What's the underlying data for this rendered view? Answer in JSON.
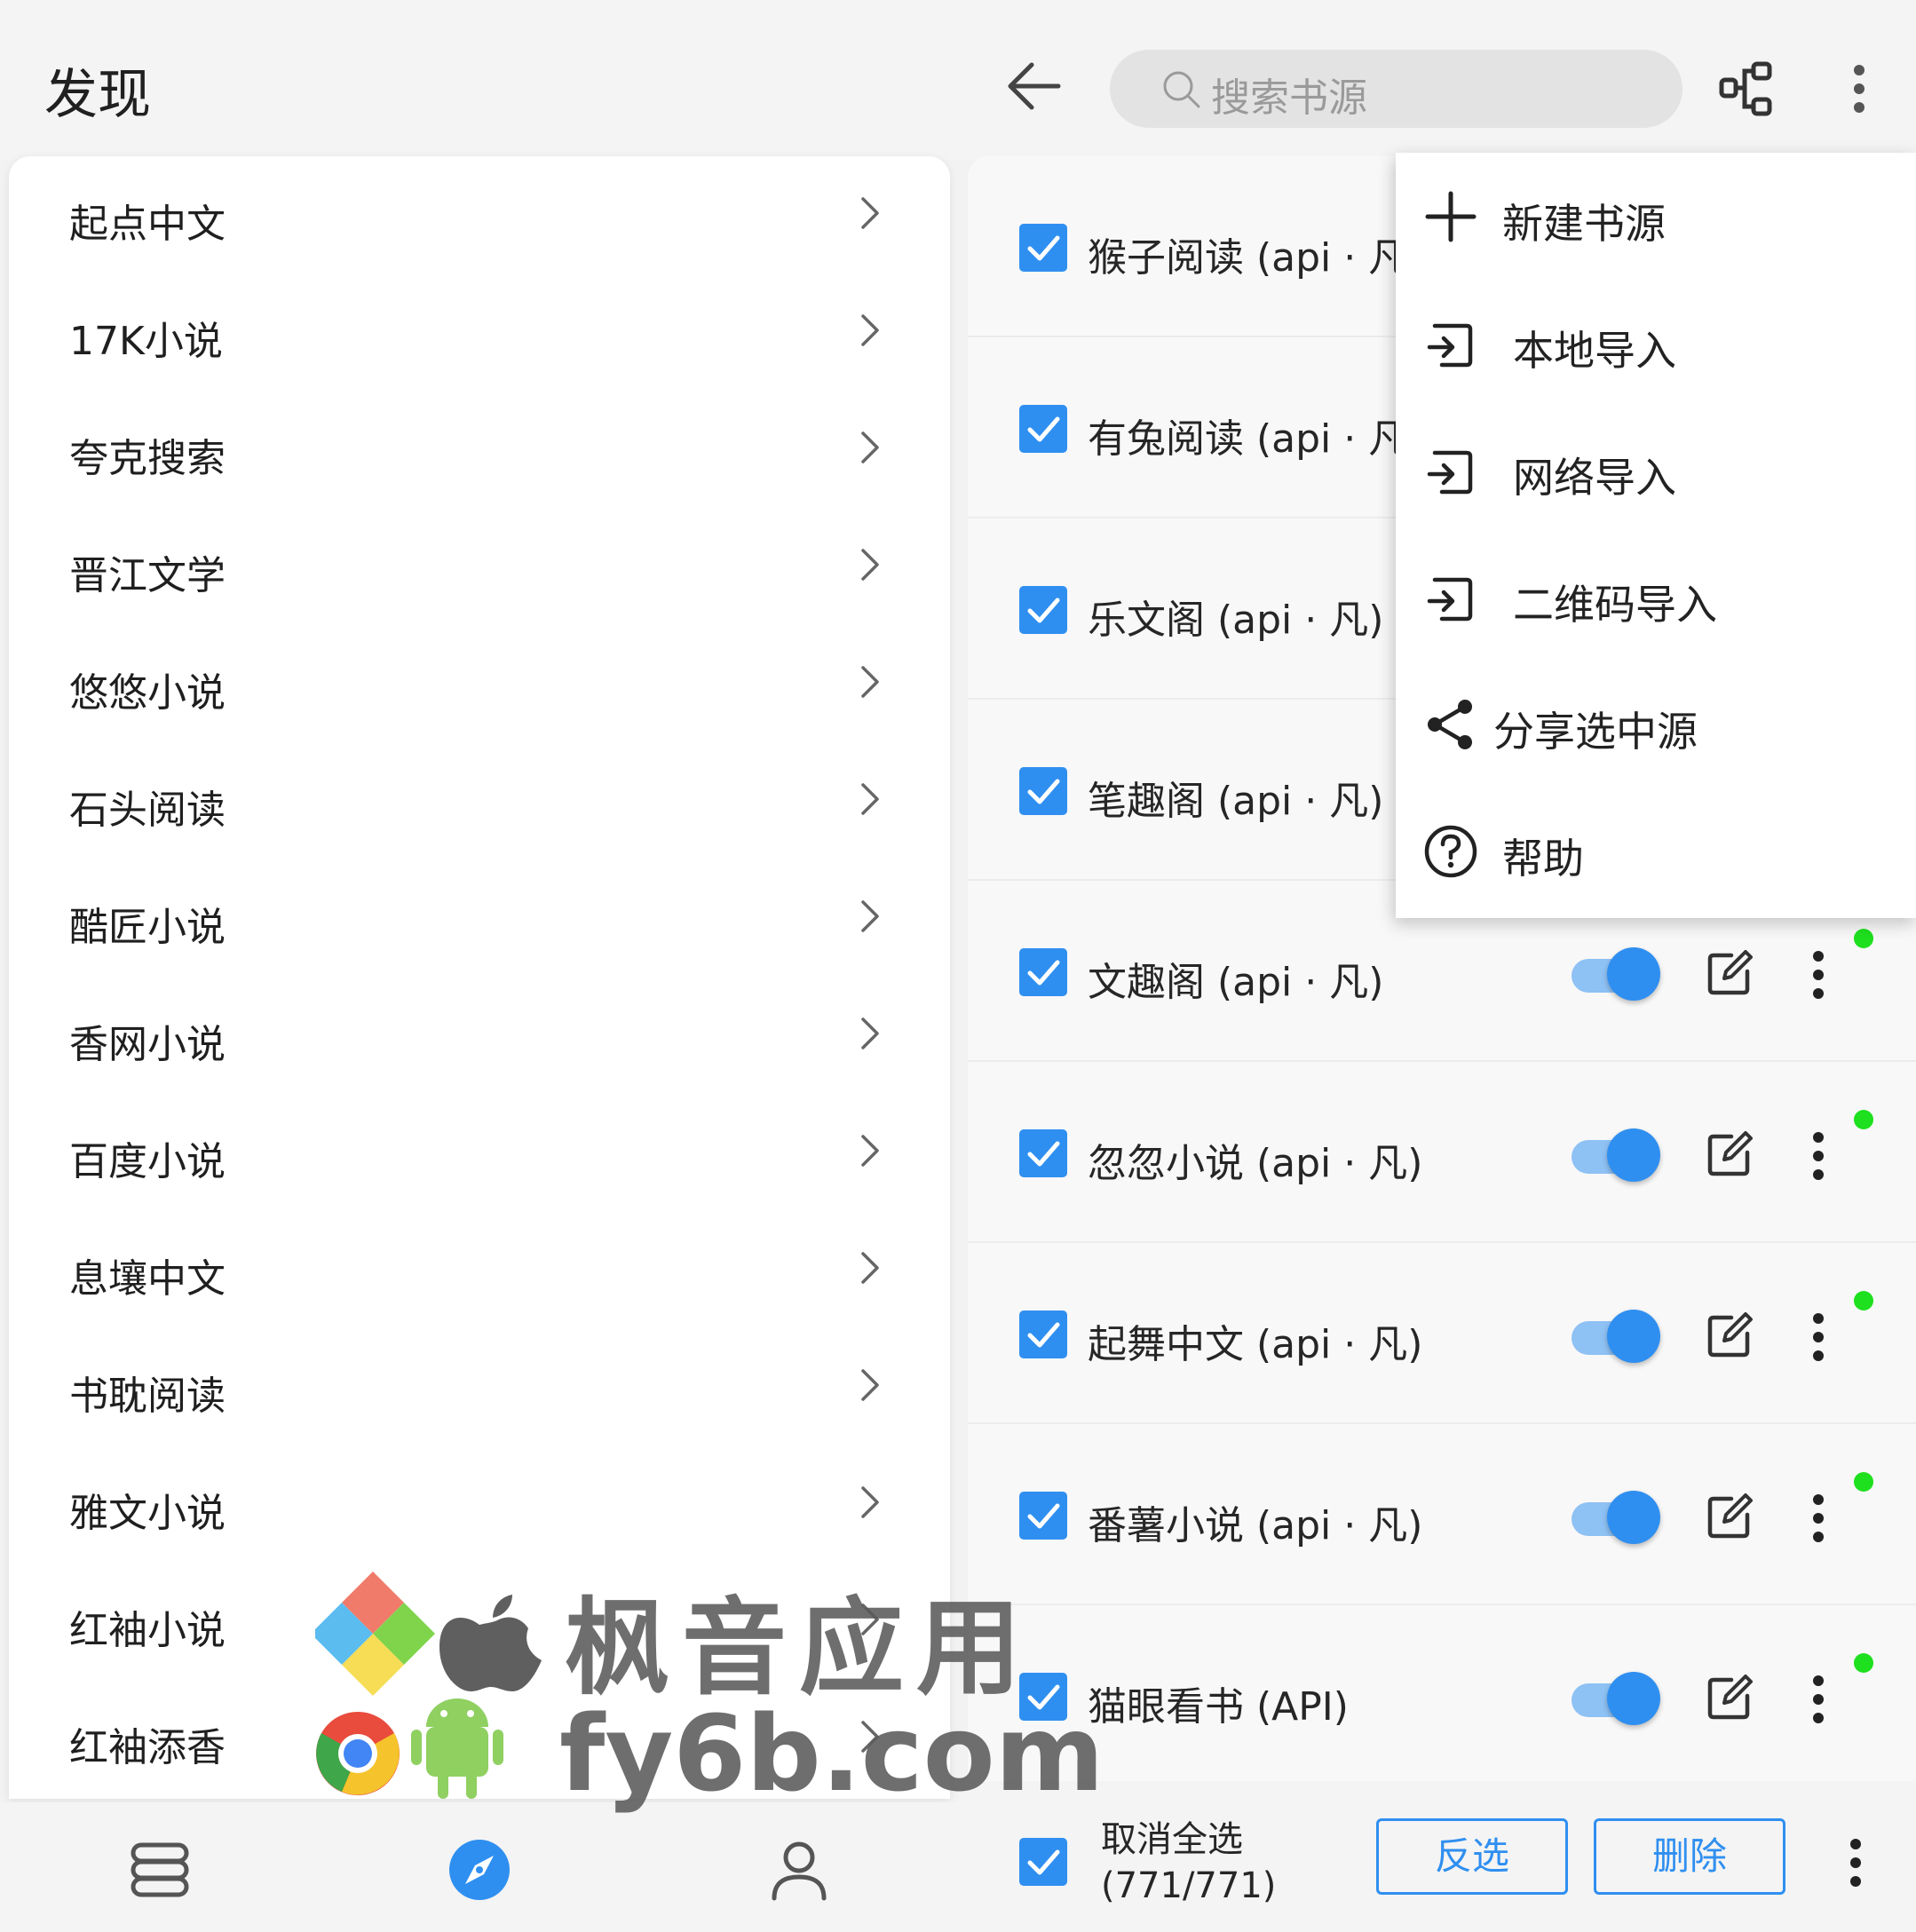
{
  "header": {
    "title": "发现",
    "search_placeholder": "搜索书源"
  },
  "explore_list": [
    "起点中文",
    "17K小说",
    "夸克搜索",
    "晋江文学",
    "悠悠小说",
    "石头阅读",
    "酷匠小说",
    "香网小说",
    "百度小说",
    "息壤中文",
    "书耽阅读",
    "雅文小说",
    "红袖小说",
    "红袖添香"
  ],
  "sources": [
    {
      "name": "猴子阅读 (api · 凡)",
      "checked": true,
      "enabled": true
    },
    {
      "name": "有兔阅读 (api · 凡)",
      "checked": true,
      "enabled": true
    },
    {
      "name": "乐文阁 (api · 凡)",
      "checked": true,
      "enabled": true
    },
    {
      "name": "笔趣阁 (api · 凡)",
      "checked": true,
      "enabled": true
    },
    {
      "name": "文趣阁 (api · 凡)",
      "checked": true,
      "enabled": true
    },
    {
      "name": "忽忽小说 (api · 凡)",
      "checked": true,
      "enabled": true
    },
    {
      "name": "起舞中文 (api · 凡)",
      "checked": true,
      "enabled": true
    },
    {
      "name": "番薯小说 (api · 凡)",
      "checked": true,
      "enabled": true
    },
    {
      "name": "猫眼看书 (API)",
      "checked": true,
      "enabled": true
    }
  ],
  "menu": [
    {
      "label": "新建书源",
      "icon": "plus-icon"
    },
    {
      "label": "本地导入",
      "icon": "import-icon"
    },
    {
      "label": "网络导入",
      "icon": "import-icon"
    },
    {
      "label": "二维码导入",
      "icon": "import-icon"
    },
    {
      "label": "分享选中源",
      "icon": "share-icon"
    },
    {
      "label": "帮助",
      "icon": "help-icon"
    }
  ],
  "selection_bar": {
    "label": "取消全选",
    "count": "(771/771)",
    "invert_label": "反选",
    "delete_label": "删除"
  },
  "bottom_nav": [
    {
      "icon": "bookshelf-icon",
      "active": false
    },
    {
      "icon": "compass-icon",
      "active": true
    },
    {
      "icon": "person-icon",
      "active": false
    }
  ],
  "watermark": {
    "line1": "枫音应用",
    "line2": "fy6b.com"
  },
  "colors": {
    "accent": "#2f8ff0",
    "status_dot": "#1ee01e",
    "toggle_track": "#8ec1f4"
  }
}
